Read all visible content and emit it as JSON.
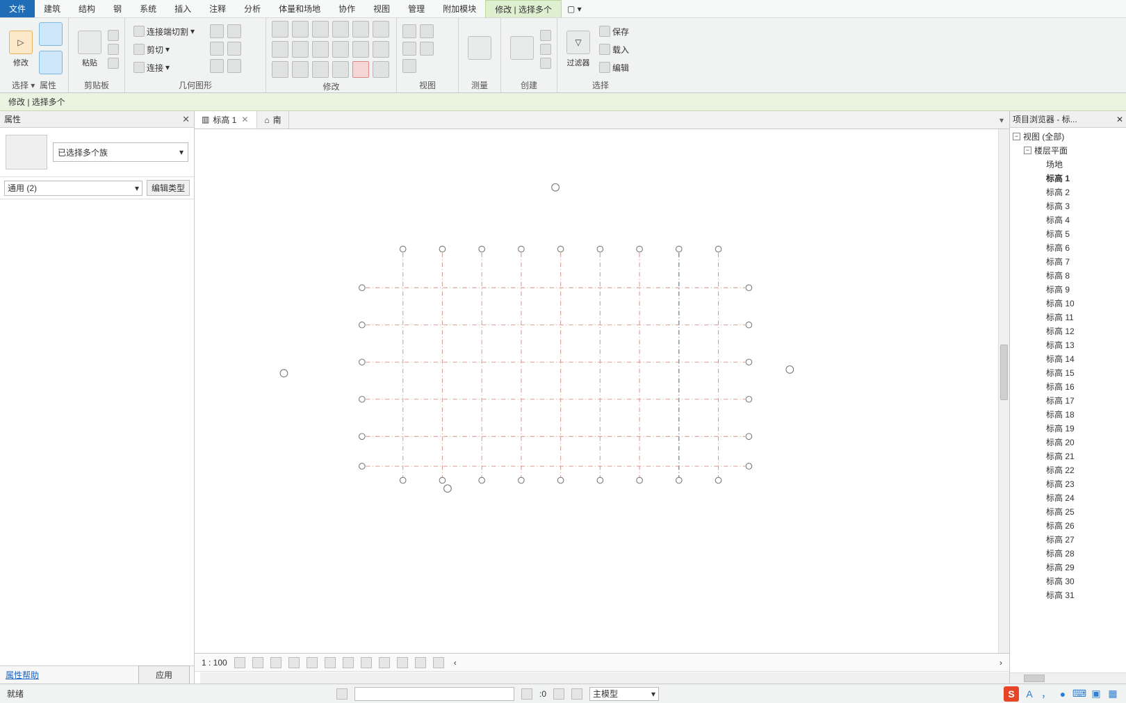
{
  "menus": {
    "file": "文件",
    "items": [
      "建筑",
      "结构",
      "钢",
      "系统",
      "插入",
      "注释",
      "分析",
      "体量和场地",
      "协作",
      "视图",
      "管理",
      "附加模块"
    ],
    "active": "修改 | 选择多个"
  },
  "ribbon": {
    "select": {
      "modify": "修改",
      "props": "属性",
      "label": "选择 ▾"
    },
    "clipboard": {
      "paste": "粘贴",
      "label": "剪贴板"
    },
    "geometry": {
      "join_cut": "连接端切割",
      "cut": "剪切",
      "join": "连接",
      "label": "几何图形"
    },
    "modify": {
      "label": "修改"
    },
    "view": {
      "label": "视图"
    },
    "measure": {
      "label": "测量"
    },
    "create": {
      "label": "创建"
    },
    "selection": {
      "filter": "过滤器",
      "save": "保存",
      "load": "载入",
      "edit": "编辑",
      "label": "选择"
    }
  },
  "selection_bar": "修改 | 选择多个",
  "properties": {
    "title": "属性",
    "type_selected": "已选择多个族",
    "common": "通用 (2)",
    "edit_type": "编辑类型",
    "help": "属性帮助",
    "apply": "应用"
  },
  "tabs": {
    "active": "标高 1",
    "other": "南"
  },
  "view_controls": {
    "scale": "1 : 100"
  },
  "browser": {
    "title": "项目浏览器 - 标...",
    "views": "视图 (全部)",
    "floor_plans": "楼层平面",
    "items": [
      "场地",
      "标高 1",
      "标高 2",
      "标高 3",
      "标高 4",
      "标高 5",
      "标高 6",
      "标高 7",
      "标高 8",
      "标高 9",
      "标高 10",
      "标高 11",
      "标高 12",
      "标高 13",
      "标高 14",
      "标高 15",
      "标高 16",
      "标高 17",
      "标高 18",
      "标高 19",
      "标高 20",
      "标高 21",
      "标高 22",
      "标高 23",
      "标高 24",
      "标高 25",
      "标高 26",
      "标高 27",
      "标高 28",
      "标高 29",
      "标高 30",
      "标高 31"
    ],
    "bold_index": 1
  },
  "status": {
    "ready": "就绪",
    "zero": ":0",
    "main_model": "主模型"
  }
}
